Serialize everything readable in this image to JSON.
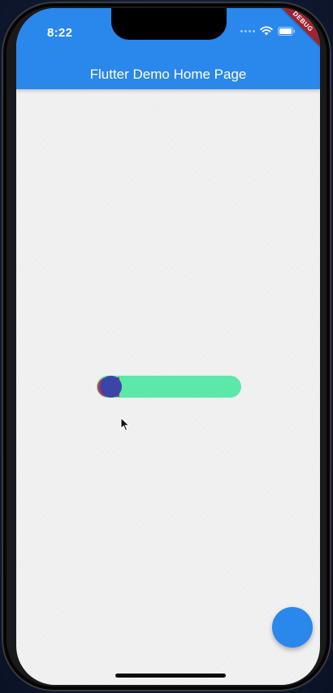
{
  "status_bar": {
    "time": "8:22"
  },
  "app_bar": {
    "title": "Flutter Demo Home Page",
    "color": "#2a87ec"
  },
  "debug_banner": {
    "label": "DEBUG",
    "color": "#a3222e"
  },
  "slider": {
    "value": 0.0,
    "track_color": "#5ce8a8",
    "thumb_color": "#3b45a8",
    "active_color": "#c8304f"
  },
  "fab": {
    "icon": "none",
    "color": "#2a87ec"
  },
  "icons": {
    "wifi": "wifi-icon",
    "battery": "battery-icon",
    "signal": "signal-dots-icon",
    "cursor": "mouse-cursor-icon"
  }
}
